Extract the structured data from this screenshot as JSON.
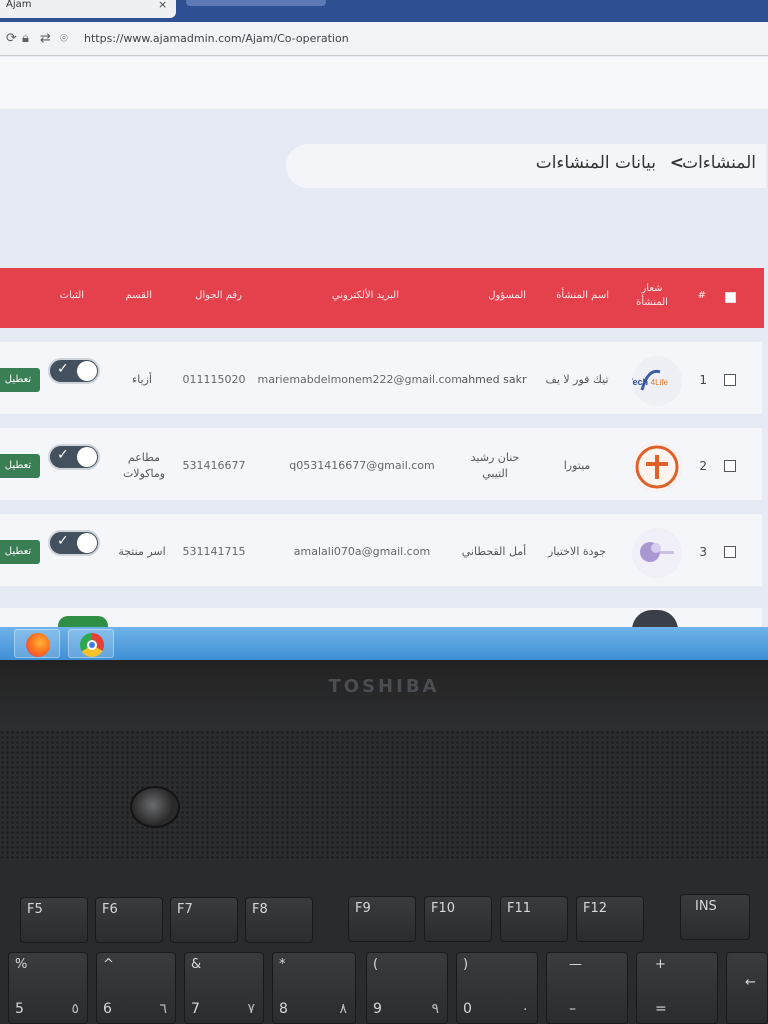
{
  "browser": {
    "tab_title": "Ajam",
    "tab_close": "×",
    "url": "https://www.ajamadmin.com/Ajam/Co-operation"
  },
  "breadcrumb": {
    "root": "المنشاءات",
    "separator": ">",
    "current": "بيانات المنشاءات"
  },
  "table": {
    "headers": {
      "number": "#",
      "logo": "شعار المنشأة",
      "name": "اسم المنشأة",
      "responsible": "المسؤول",
      "email": "البريد الألكتروني",
      "phone": "رقم الجوال",
      "category": "القسم",
      "status": "الثبات"
    },
    "rows": [
      {
        "number": "1",
        "logo": "tech4life-logo",
        "name": "تيك فور لا يف",
        "responsible": "ahmed sakr",
        "email": "mariemabdelmonem222@gmail.com",
        "phone": "011115020",
        "category": "أزياء",
        "active": true,
        "action": "تعطيل"
      },
      {
        "number": "2",
        "logo": "orange-circle-logo",
        "name": "ميتورا",
        "responsible": "حنان رشيد التيبي",
        "email": "q0531416677@gmail.com",
        "phone": "531416677",
        "category": "مطاعم وماكولات",
        "active": true,
        "action": "تعطيل"
      },
      {
        "number": "3",
        "logo": "purple-circle-logo",
        "name": "جودة الاختيار",
        "responsible": "أمل القحطاني",
        "email": "amalali070a@gmail.com",
        "phone": "531141715",
        "category": "اسر منتجة",
        "active": true,
        "action": "تعطيل"
      }
    ]
  },
  "keyboard": {
    "fn_row": [
      "F5",
      "F6",
      "F7",
      "F8",
      "F9",
      "F10",
      "F11",
      "F12",
      "INS"
    ],
    "num_row": [
      {
        "top": "%",
        "bottom": "5",
        "alt": "٥"
      },
      {
        "top": "^",
        "bottom": "6",
        "alt": "٦"
      },
      {
        "top": "&",
        "bottom": "7",
        "alt": "٧"
      },
      {
        "top": "*",
        "bottom": "8",
        "alt": "٨"
      },
      {
        "top": "(",
        "bottom": "9",
        "alt": "٩"
      },
      {
        "top": ")",
        "bottom": "0",
        "alt": "٠"
      },
      {
        "top": "—",
        "bottom": "–",
        "alt": ""
      },
      {
        "top": "+",
        "bottom": "=",
        "alt": ""
      }
    ]
  },
  "brand": "TOSHIBA"
}
